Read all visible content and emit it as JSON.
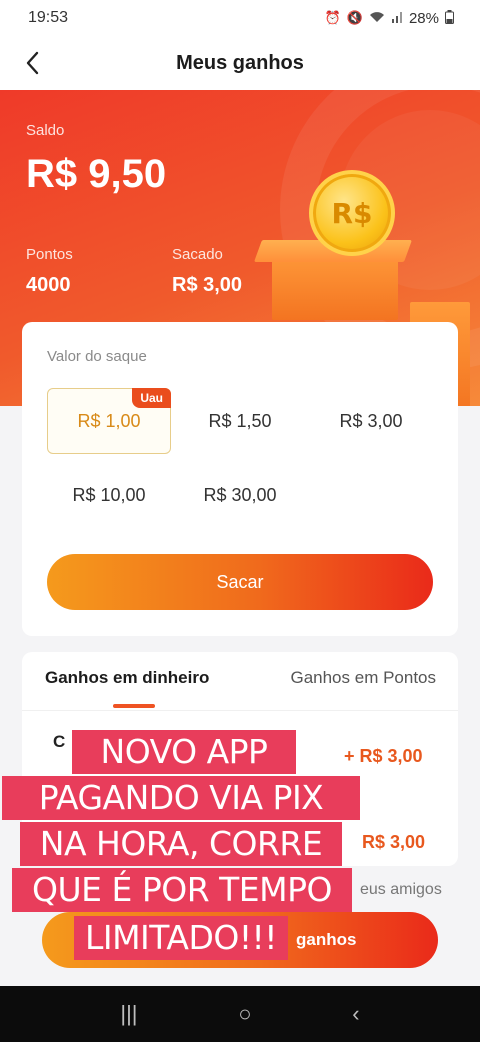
{
  "status_bar": {
    "time": "19:53",
    "battery": "28%",
    "icons": [
      "alarm-icon",
      "mute-icon",
      "wifi-icon",
      "signal-icon",
      "battery-icon"
    ]
  },
  "header": {
    "title": "Meus ganhos",
    "back_icon": "chevron-left-icon"
  },
  "balance": {
    "saldo_label": "Saldo",
    "saldo_value": "R$ 9,50",
    "pontos_label": "Pontos",
    "pontos_value": "4000",
    "sacado_label": "Sacado",
    "sacado_value": "R$ 3,00",
    "coin_text": "R$"
  },
  "withdraw": {
    "label": "Valor do saque",
    "options": [
      {
        "label": "R$ 1,00",
        "badge": "Uau",
        "selected": true
      },
      {
        "label": "R$ 1,50"
      },
      {
        "label": "R$ 3,00"
      },
      {
        "label": "R$ 10,00"
      },
      {
        "label": "R$ 30,00"
      }
    ],
    "button_label": "Sacar"
  },
  "earnings": {
    "tabs": [
      "Ganhos em dinheiro",
      "Ganhos em Pontos"
    ],
    "active_tab": 0,
    "row1_prefix": "C",
    "row1_amount": "+ R$ 3,00",
    "row2_amount": "R$ 3,00"
  },
  "friends_text": "eus amigos",
  "bottom_button_label": "ganhos",
  "promo": {
    "lines": [
      "NOVO APP",
      "PAGANDO VIA PIX",
      "NA HORA, CORRE",
      "QUE É POR TEMPO",
      "LIMITADO!!!"
    ]
  },
  "system_nav": {
    "recents": "|||",
    "home": "○",
    "back": "‹"
  },
  "colors": {
    "accent": "#EF5323",
    "hero_top": "#EF3A29",
    "promo_bg": "#E83D5B",
    "gold": "#D88A18"
  }
}
